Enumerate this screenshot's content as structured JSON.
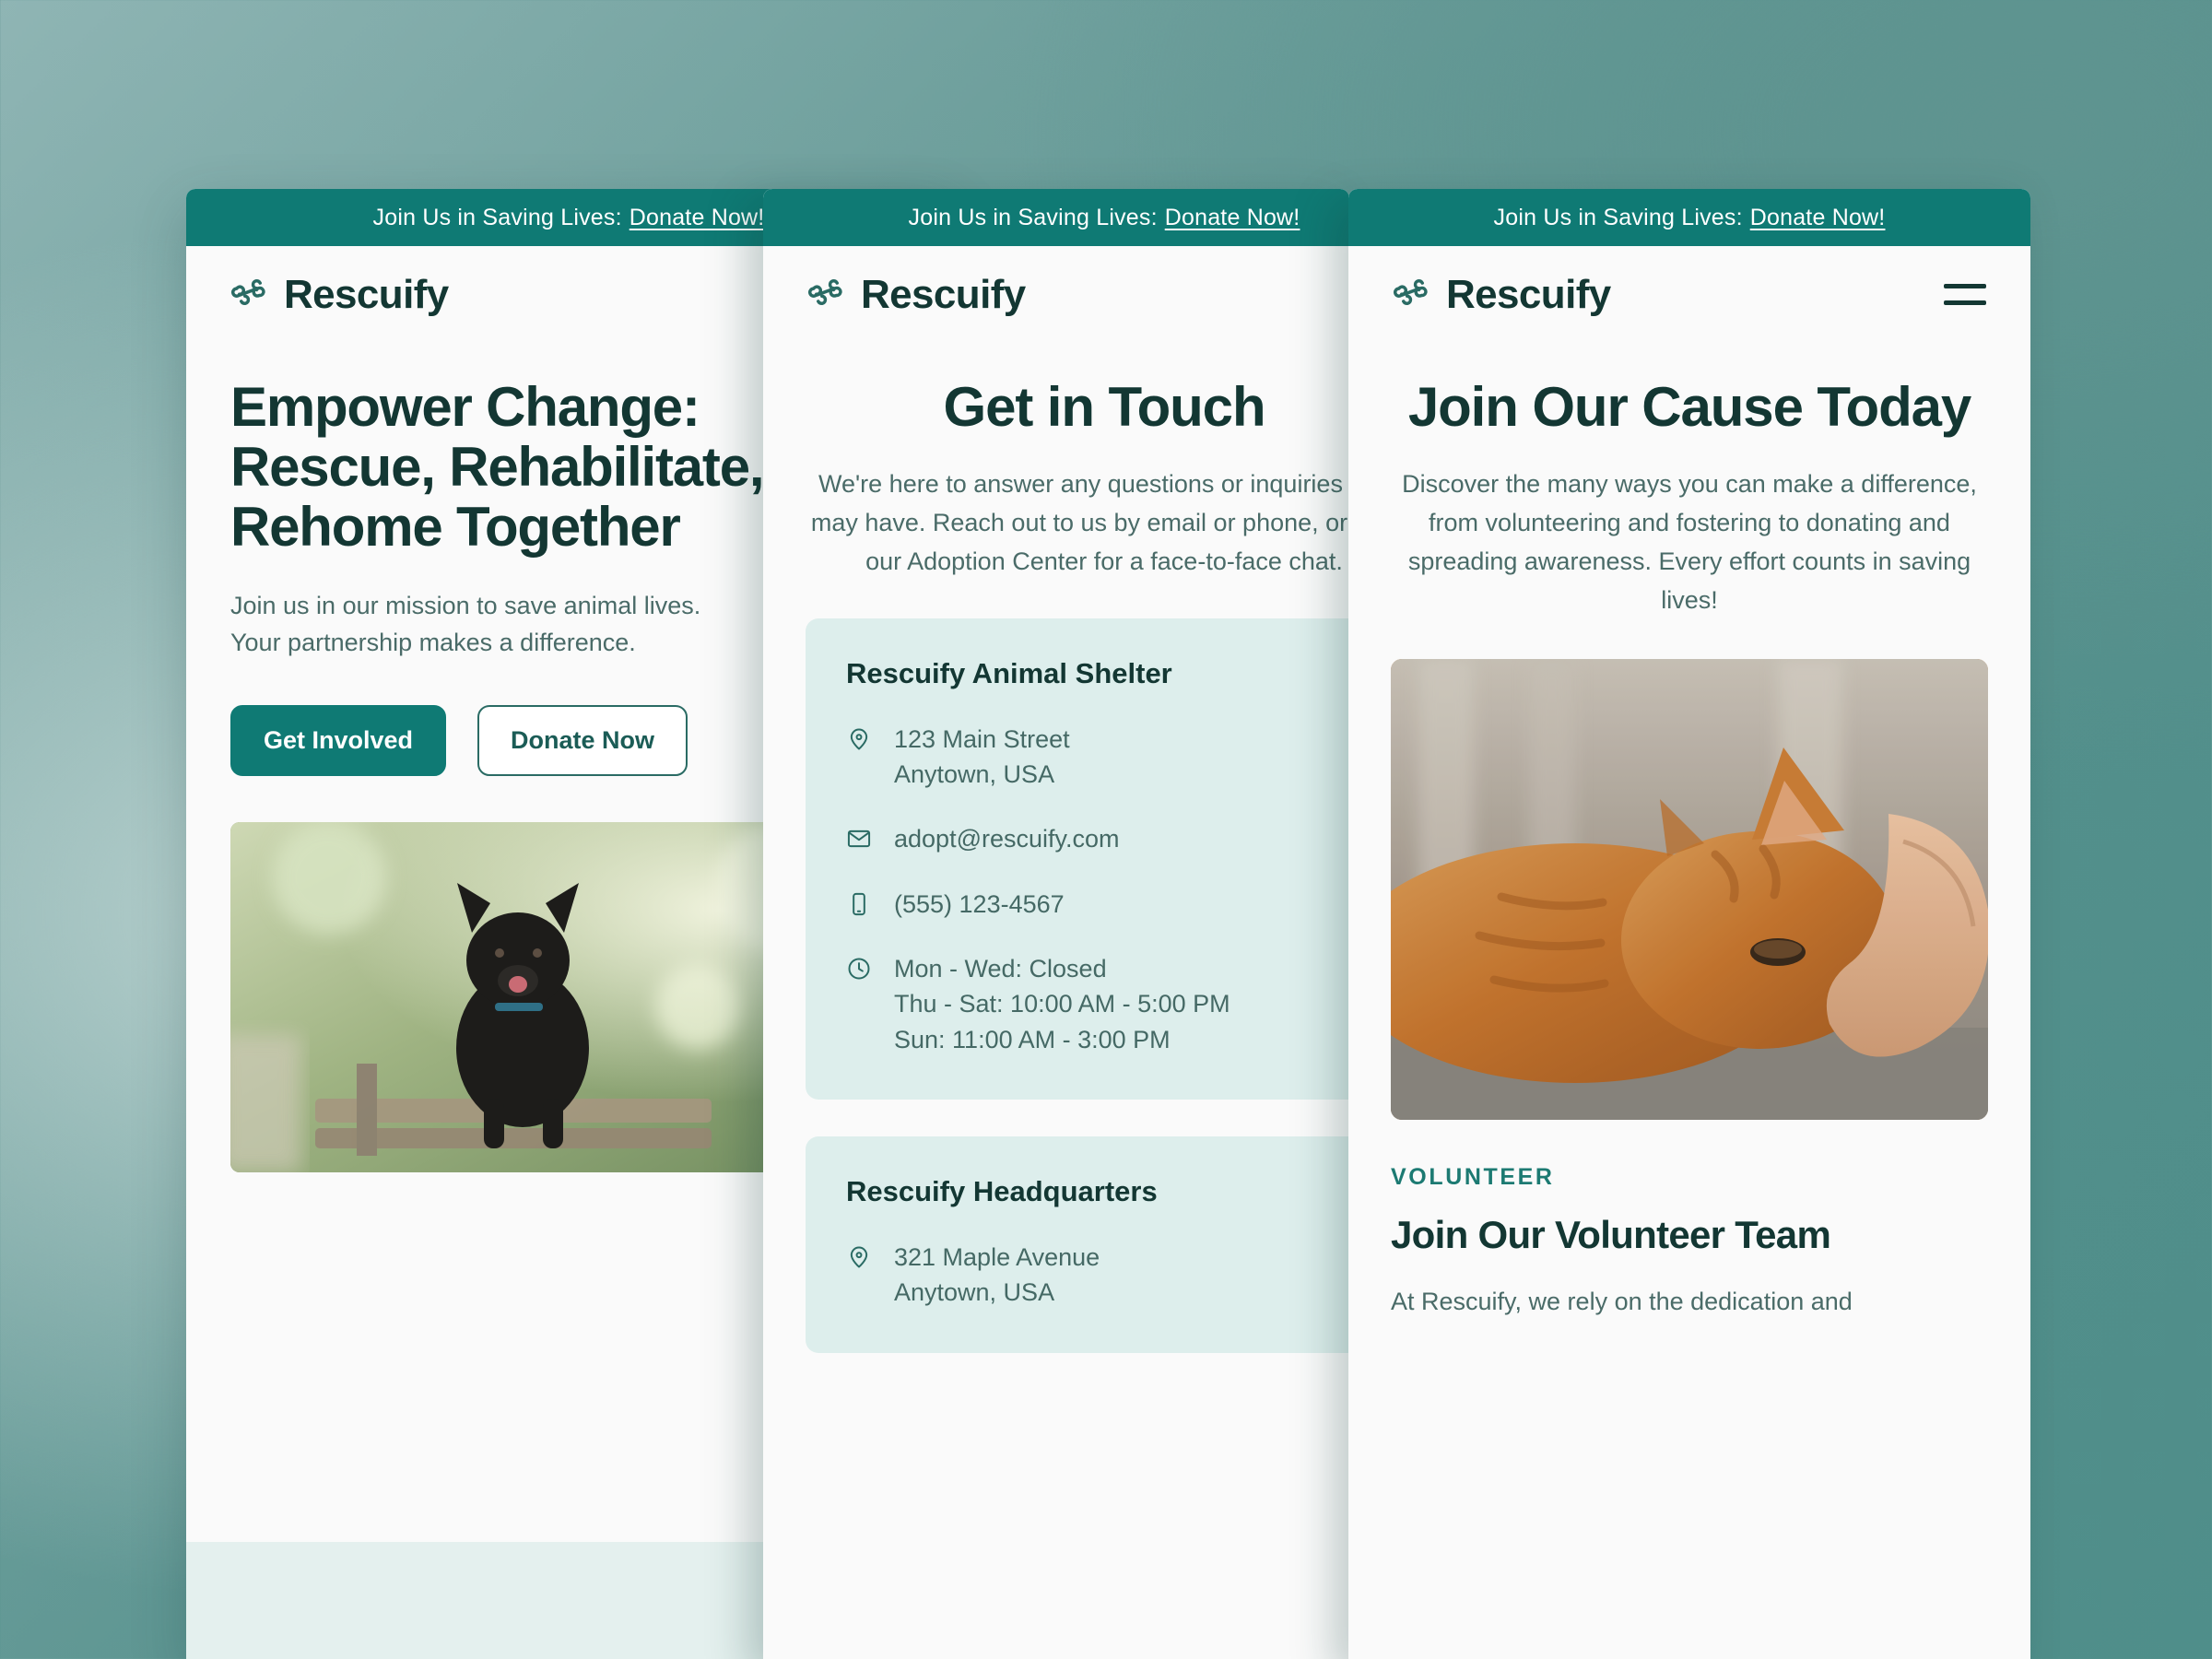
{
  "theme": {
    "banner_bg": "#0f7a74",
    "brand_dark": "#133733",
    "accent": "#1c7a72",
    "card_bg": "#ddeeec",
    "panel_bg": "#fafafa",
    "body_text": "#4a6b68"
  },
  "banner": {
    "text": "Join Us in Saving Lives:",
    "link_label": "Donate Now!"
  },
  "brand": {
    "name": "Rescuify",
    "logo_icon": "bone-icon"
  },
  "panel1": {
    "hero_title": "Empower Change:\nRescue, Rehabilitate,\nRehome Together",
    "hero_subtitle": "Join us in our mission to save animal lives.\nYour partnership makes a difference.",
    "primary_button": "Get Involved",
    "secondary_button": "Donate Now",
    "hero_image_alt": "black-dog-on-bench-photo"
  },
  "panel2": {
    "title": "Get in Touch",
    "subtitle": "We're here to answer any questions or inquiries you may have. Reach out to us by email or phone, or visit our Adoption Center for a face-to-face chat.",
    "cards": [
      {
        "title": "Rescuify Animal Shelter",
        "rows": [
          {
            "icon": "map-pin-icon",
            "lines": [
              "123 Main Street",
              "Anytown, USA"
            ]
          },
          {
            "icon": "envelope-icon",
            "lines": [
              "adopt@rescuify.com"
            ]
          },
          {
            "icon": "phone-icon",
            "lines": [
              "(555) 123-4567"
            ]
          },
          {
            "icon": "clock-icon",
            "lines": [
              "Mon - Wed: Closed",
              "Thu - Sat: 10:00 AM - 5:00 PM",
              "Sun: 11:00 AM - 3:00 PM"
            ]
          }
        ]
      },
      {
        "title": "Rescuify Headquarters",
        "rows": [
          {
            "icon": "map-pin-icon",
            "lines": [
              "321 Maple Avenue",
              "Anytown, USA"
            ]
          }
        ]
      }
    ]
  },
  "panel3": {
    "title": "Join Our Cause Today",
    "subtitle": "Discover the many ways you can make a difference, from volunteering and fostering to donating and spreading awareness. Every effort counts in saving lives!",
    "image_alt": "orange-cat-being-petted-photo",
    "eyebrow": "VOLUNTEER",
    "volunteer_title": "Join Our Volunteer Team",
    "volunteer_body": "At Rescuify, we rely on the dedication and",
    "menu_icon": "hamburger-menu-icon"
  }
}
